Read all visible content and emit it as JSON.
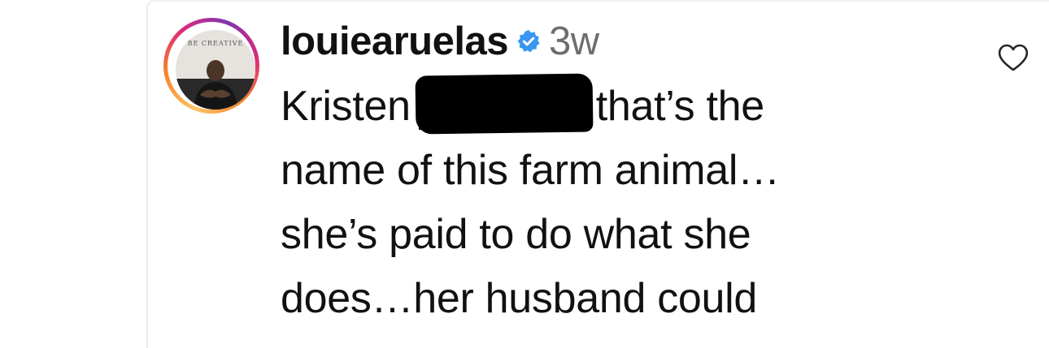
{
  "comment": {
    "username": "louiearuelas",
    "verified": true,
    "timestamp": "3w",
    "avatar_text": "BE CREATIVE",
    "text_lines": {
      "line1_before": "Kristen",
      "line1_after": "that’s the",
      "line2": "name of this farm animal…",
      "line3": "she’s paid to do what she",
      "line4": "does…her husband could"
    },
    "redacted": true
  },
  "icons": {
    "verified": "verified-badge-icon",
    "like": "heart-icon"
  },
  "colors": {
    "verified_blue": "#3897f0",
    "timestamp_gray": "#6e6e6e",
    "text": "#111111"
  }
}
